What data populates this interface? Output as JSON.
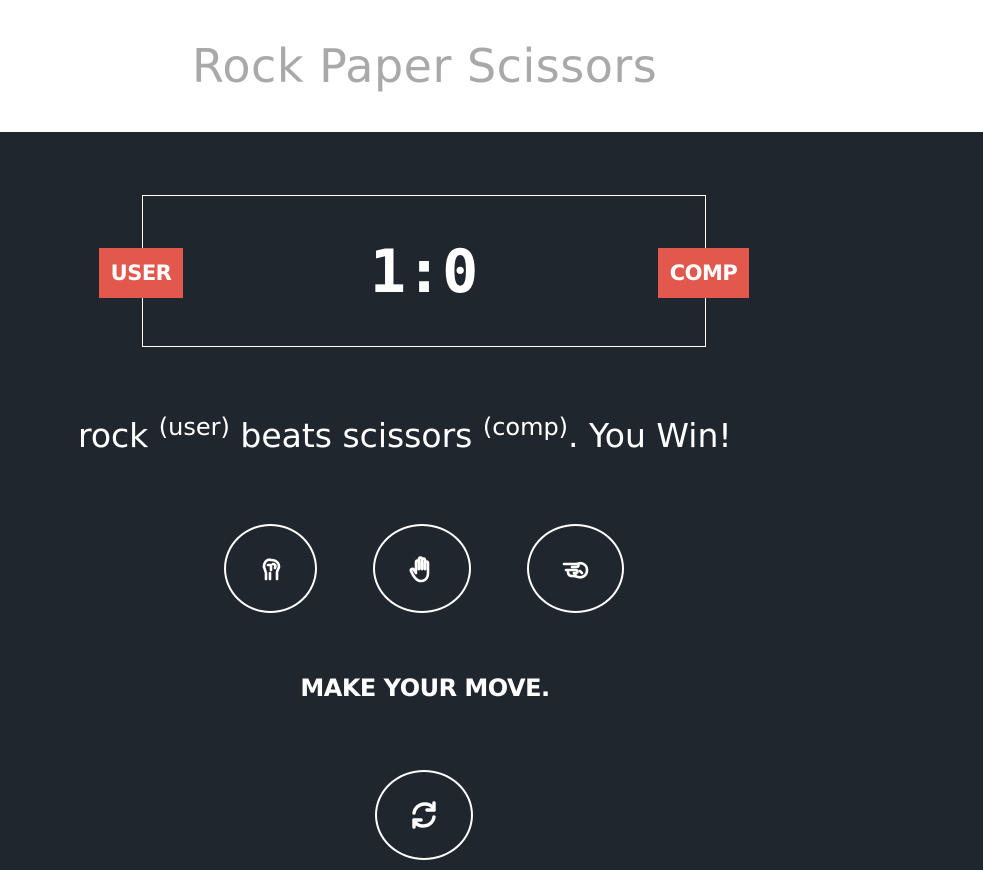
{
  "header": {
    "title": "Rock Paper Scissors"
  },
  "scoreboard": {
    "user_label": "User",
    "comp_label": "Comp",
    "user_score": "1",
    "separator": ":",
    "comp_score": "0"
  },
  "result": {
    "user_choice": "rock",
    "user_tag": "(user)",
    "verb": "beats",
    "comp_choice": "scissors",
    "comp_tag": "(comp)",
    "outcome": ". You Win!"
  },
  "choices": [
    {
      "name": "rock",
      "icon": "hand-rock-icon"
    },
    {
      "name": "paper",
      "icon": "hand-paper-icon"
    },
    {
      "name": "scissors",
      "icon": "hand-scissors-icon"
    }
  ],
  "action_message": "Make your move.",
  "reset_icon": "refresh-icon",
  "colors": {
    "background": "#20262e",
    "badge": "#e2584d",
    "title": "#a9a9a9"
  }
}
